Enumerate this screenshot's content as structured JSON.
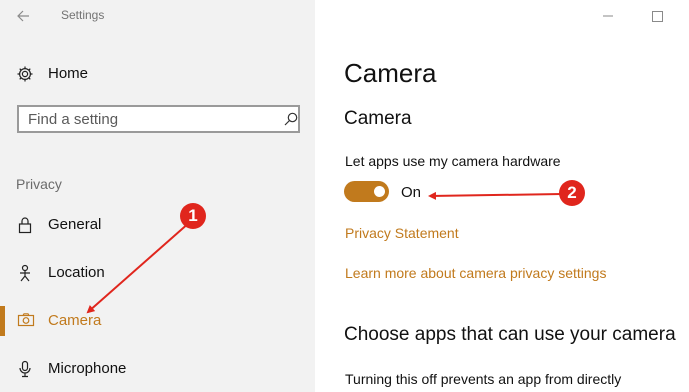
{
  "window": {
    "title": "Settings",
    "back_icon": "back-arrow-icon",
    "minimize_icon": "minimize-icon",
    "maximize_icon": "maximize-icon"
  },
  "sidebar": {
    "home": {
      "label": "Home",
      "icon": "gear-icon"
    },
    "search": {
      "placeholder": "Find a setting",
      "value": "",
      "icon": "search-icon"
    },
    "section_title": "Privacy",
    "items": [
      {
        "label": "General",
        "icon": "lock-icon",
        "active": false
      },
      {
        "label": "Location",
        "icon": "location-person-icon",
        "active": false
      },
      {
        "label": "Camera",
        "icon": "camera-icon",
        "active": true
      },
      {
        "label": "Microphone",
        "icon": "microphone-icon",
        "active": false
      }
    ]
  },
  "main": {
    "page_title": "Camera",
    "subheading": "Camera",
    "toggle": {
      "label": "Let apps use my camera hardware",
      "state_label": "On",
      "on": true
    },
    "links": {
      "privacy_statement": "Privacy Statement",
      "learn_more": "Learn more about camera privacy settings"
    },
    "apps_heading": "Choose apps that can use your camera",
    "apps_description": "Turning this off prevents an app from directly"
  },
  "annotations": [
    {
      "number": "1"
    },
    {
      "number": "2"
    }
  ],
  "colors": {
    "accent": "#c17a1d",
    "annotation": "#e0261d",
    "sidebar_bg": "#f2f2f2"
  }
}
